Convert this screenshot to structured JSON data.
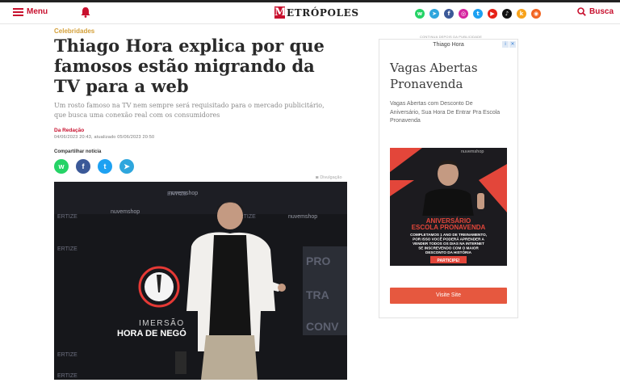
{
  "header": {
    "menu_label": "Menu",
    "logo_mark": "M",
    "logo_text": "ETRÓPOLES",
    "search_label": "Busca",
    "socials": [
      {
        "name": "whatsapp-icon",
        "color": "#25d366",
        "glyph": "w"
      },
      {
        "name": "telegram-icon",
        "color": "#2ea6dd",
        "glyph": "➤"
      },
      {
        "name": "facebook-icon",
        "color": "#3b5998",
        "glyph": "f"
      },
      {
        "name": "instagram-icon",
        "color": "#d6249f",
        "glyph": "◎"
      },
      {
        "name": "twitter-icon",
        "color": "#1da1f2",
        "glyph": "t"
      },
      {
        "name": "youtube-icon",
        "color": "#e62117",
        "glyph": "▶"
      },
      {
        "name": "tiktok-icon",
        "color": "#111111",
        "glyph": "♪"
      },
      {
        "name": "kwai-icon",
        "color": "#f7a21b",
        "glyph": "k"
      },
      {
        "name": "rss-icon",
        "color": "#f26522",
        "glyph": "◉"
      }
    ]
  },
  "article": {
    "category": "Celebridades",
    "title": "Thiago Hora explica por que famosos estão migrando da TV para a web",
    "subtitle": "Um rosto famoso na TV nem sempre será requisitado para o mercado publicitário, que busca uma conexão real com os consumidores",
    "author": "Da Redação",
    "dateline": "04/06/2023 20:43, atualizado 05/06/2023 20:50",
    "share_label": "Compartilhar notícia",
    "share_buttons": [
      {
        "name": "share-whatsapp-button",
        "color": "#25d366",
        "glyph": "w"
      },
      {
        "name": "share-facebook-button",
        "color": "#3b5998",
        "glyph": "f"
      },
      {
        "name": "share-twitter-button",
        "color": "#1da1f2",
        "glyph": "t"
      },
      {
        "name": "share-telegram-button",
        "color": "#2ea6dd",
        "glyph": "➤"
      }
    ],
    "photo_credit": "Divulgação",
    "photo": {
      "sign_main": "IMERSÃO",
      "sign_sub": "HORA DE NEGÓ",
      "brand": "nuvemshop",
      "backdrop_words": [
        "ERTIZE",
        "PRO",
        "TRA",
        "CONV",
        "ERTIZE",
        "ERTIZE",
        "ERTIZE",
        "ERTIZE",
        "ERTIZE"
      ]
    }
  },
  "ad": {
    "label": "CONTINUA DEPOIS DA PUBLICIDADE",
    "top_label": "Thiago Hora",
    "title": "Vagas Abertas Pronavenda",
    "description": "Vagas Abertas com Desconto De Aniversário, Sua Hora De Entrar Pra Escola Pronavenda",
    "image_headline": "ANIVERSÁRIO ESCOLA PRONAVENDA",
    "image_text": "COMPLETAMOS 1 ANO DE TREINAMENTO, POR ISSO VOCÊ PODERÁ APRENDER A VENDER TODOS OS DIAS NA INTERNET SE INSCREVENDO COM O MAIOR DESCONTO DA HISTÓRIA",
    "image_cta": "PARTICIPE!",
    "image_brand": "nuvemshop",
    "button_label": "Visite Site"
  },
  "colors": {
    "brand_red": "#c8102e",
    "category_gold": "#d4a03a",
    "ad_button": "#e6583f"
  }
}
